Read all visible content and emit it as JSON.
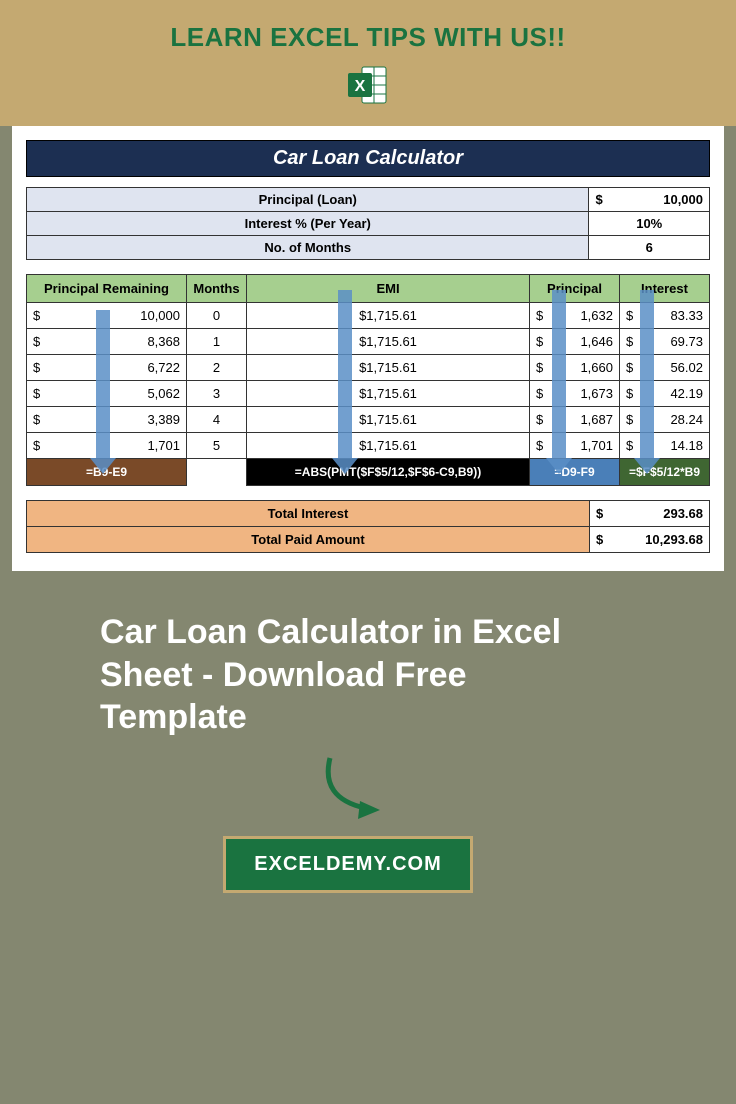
{
  "banner": {
    "title": "LEARN EXCEL TIPS WITH US!!"
  },
  "sheet": {
    "title": "Car Loan Calculator",
    "inputs": [
      {
        "label": "Principal (Loan)",
        "value": "10,000",
        "currency": "$"
      },
      {
        "label": "Interest % (Per Year)",
        "value": "10%",
        "currency": ""
      },
      {
        "label": "No. of Months",
        "value": "6",
        "currency": ""
      }
    ],
    "headers": {
      "pr": "Principal Remaining",
      "mo": "Months",
      "emi": "EMI",
      "p": "Principal",
      "i": "Interest"
    },
    "rows": [
      {
        "pr": "10,000",
        "mo": "0",
        "emi": "$1,715.61",
        "p": "1,632",
        "i": "83.33"
      },
      {
        "pr": "8,368",
        "mo": "1",
        "emi": "$1,715.61",
        "p": "1,646",
        "i": "69.73"
      },
      {
        "pr": "6,722",
        "mo": "2",
        "emi": "$1,715.61",
        "p": "1,660",
        "i": "56.02"
      },
      {
        "pr": "5,062",
        "mo": "3",
        "emi": "$1,715.61",
        "p": "1,673",
        "i": "42.19"
      },
      {
        "pr": "3,389",
        "mo": "4",
        "emi": "$1,715.61",
        "p": "1,687",
        "i": "28.24"
      },
      {
        "pr": "1,701",
        "mo": "5",
        "emi": "$1,715.61",
        "p": "1,701",
        "i": "14.18"
      }
    ],
    "formulas": {
      "pr": "=B9-E9",
      "emi": "=ABS(PMT($F$5/12,$F$6-C9,B9))",
      "p": "=D9-F9",
      "i": "=$F$5/12*B9"
    },
    "totals": [
      {
        "label": "Total Interest",
        "value": "293.68"
      },
      {
        "label": "Total Paid Amount",
        "value": "10,293.68"
      }
    ]
  },
  "article": {
    "title": "Car Loan Calculator in Excel Sheet - Download Free Template",
    "site": "EXCELDEMY.COM"
  },
  "chart_data": {
    "type": "table",
    "title": "Car Loan Calculator",
    "inputs": {
      "principal": 10000,
      "interest_pct_per_year": 10,
      "months": 6
    },
    "columns": [
      "Principal Remaining",
      "Months",
      "EMI",
      "Principal",
      "Interest"
    ],
    "rows": [
      [
        10000,
        0,
        1715.61,
        1632,
        83.33
      ],
      [
        8368,
        1,
        1715.61,
        1646,
        69.73
      ],
      [
        6722,
        2,
        1715.61,
        1660,
        56.02
      ],
      [
        5062,
        3,
        1715.61,
        1673,
        42.19
      ],
      [
        3389,
        4,
        1715.61,
        1687,
        28.24
      ],
      [
        1701,
        5,
        1715.61,
        1701,
        14.18
      ]
    ],
    "totals": {
      "total_interest": 293.68,
      "total_paid": 10293.68
    },
    "formulas": {
      "principal_remaining": "=B9-E9",
      "emi": "=ABS(PMT($F$5/12,$F$6-C9,B9))",
      "principal": "=D9-F9",
      "interest": "=$F$5/12*B9"
    }
  }
}
